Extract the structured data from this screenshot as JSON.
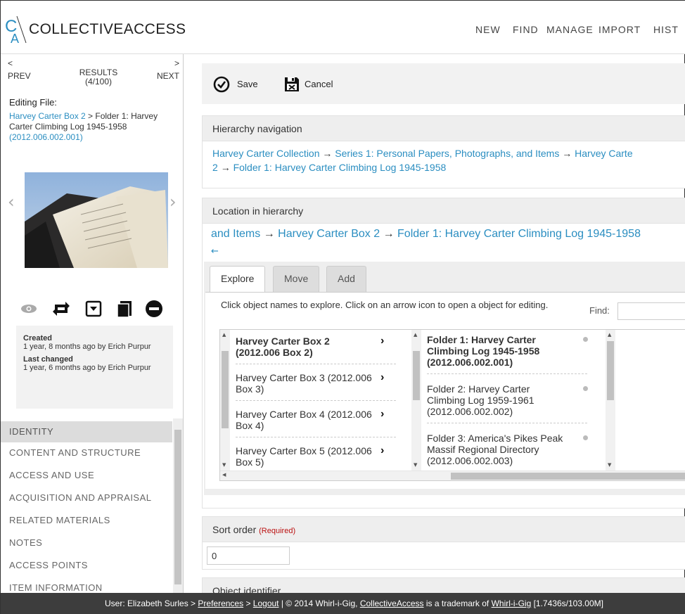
{
  "header": {
    "logo_text": "COLLECTIVEACCESS",
    "nav": [
      "NEW",
      "FIND",
      "MANAGE",
      "IMPORT",
      "HIST"
    ]
  },
  "sidebar": {
    "prev_arrow": "<",
    "prev_label": "PREV",
    "next_arrow": ">",
    "next_label": "NEXT",
    "results_label": "RESULTS",
    "results_count": "(4/100)",
    "editing_label": "Editing File:",
    "editing_parent": "Harvey Carter Box 2",
    "editing_sep": " > ",
    "editing_title": "Folder 1: Harvey Carter Climbing Log 1945-1958",
    "editing_idno": "(2012.006.002.001)",
    "created_label": "Created",
    "created_value": "1 year, 8 months ago by Erich Purpur",
    "changed_label": "Last changed",
    "changed_value": "1 year, 6 months ago by Erich Purpur",
    "sections": [
      {
        "label": "IDENTITY"
      },
      {
        "label": "CONTENT AND STRUCTURE"
      },
      {
        "label": "ACCESS AND USE"
      },
      {
        "label": "ACQUISITION AND APPRAISAL"
      },
      {
        "label": "RELATED MATERIALS"
      },
      {
        "label": "NOTES"
      },
      {
        "label": "ACCESS POINTS"
      },
      {
        "label": "ITEM INFORMATION"
      }
    ]
  },
  "savebar": {
    "save_label": "Save",
    "cancel_label": "Cancel"
  },
  "hierarchy_nav": {
    "title": "Hierarchy navigation",
    "items": [
      "Harvey Carter Collection",
      "Series 1: Personal Papers, Photographs, and Items",
      "Harvey Carter Box 2",
      "Folder 1: Harvey Carter Climbing Log 1945-1958"
    ],
    "line1_end": "Harvey Carte",
    "line2_start": "2"
  },
  "location": {
    "title": "Location in hierarchy",
    "crumb_start": "and Items",
    "crumb_box": "Harvey Carter Box 2",
    "crumb_folder": "Folder 1: Harvey Carter Climbing Log 1945-1958",
    "back_arrow": "←",
    "tabs": [
      "Explore",
      "Move",
      "Add"
    ],
    "instructions": "Click object names to explore. Click on an arrow icon to open a object for editing.",
    "find_label": "Find:",
    "find_value": "",
    "col1": [
      {
        "label": "Harvey Carter Box 2 (2012.006 Box 2)",
        "bold": true
      },
      {
        "label": "Harvey Carter Box 3 (2012.006 Box 3)",
        "bold": false
      },
      {
        "label": "Harvey Carter Box 4 (2012.006 Box 4)",
        "bold": false
      },
      {
        "label": "Harvey Carter Box 5 (2012.006 Box 5)",
        "bold": false
      }
    ],
    "col2": [
      {
        "label": "Folder 1: Harvey Carter Climbing Log 1945-1958 (2012.006.002.001)",
        "bold": true
      },
      {
        "label": "Folder 2: Harvey Carter Climbing Log 1959-1961 (2012.006.002.002)",
        "bold": false
      },
      {
        "label": "Folder 3: America's Pikes Peak Massif Regional Directory (2012.006.002.003)",
        "bold": false
      }
    ]
  },
  "sort_order": {
    "title": "Sort order",
    "required": "(Required)",
    "value": "0"
  },
  "object_identifier": {
    "title": "Object identifier"
  },
  "footer": {
    "user": "User: Elizabeth Surles > ",
    "preferences": "Preferences",
    "sep1": " > ",
    "logout": "Logout",
    "mid": "  |  © 2014 Whirl-i-Gig, ",
    "ca_link": "CollectiveAccess",
    "trademark": " is a trademark of ",
    "wig_link": "Whirl-i-Gig",
    "timing": " [1.7436s/103.00M]"
  },
  "icons": {
    "logo": "collectiveaccess-logo-icon",
    "save": "check-circle-icon",
    "cancel": "disk-cancel-icon",
    "view": "eye-icon",
    "duplicate": "swap-icon",
    "change_type": "dropdown-box-icon",
    "copy": "document-copy-icon",
    "delete": "minus-circle-icon"
  },
  "colors": {
    "link": "#2b8ec1",
    "required": "#b11111",
    "footer_bg": "#3d3d3d",
    "panel_header": "#eeeeee"
  }
}
